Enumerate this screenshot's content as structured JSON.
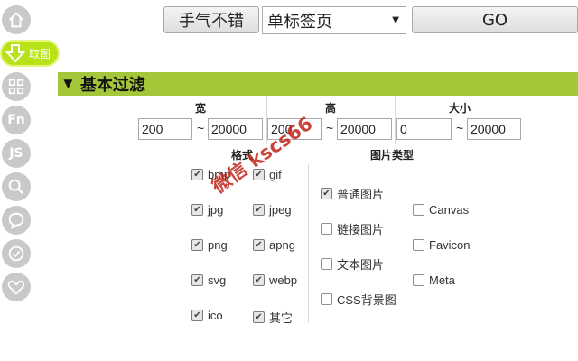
{
  "toolbar": {
    "lucky_button": "手气不错",
    "mode_select": "单标签页",
    "go_button": "GO"
  },
  "sidebar": {
    "active_label": "取图",
    "fn_label": "Fn",
    "js_label": "JS",
    "icons": [
      "home-icon",
      "download-icon",
      "grid-icon",
      "fn-icon",
      "js-icon",
      "search-icon",
      "chat-icon",
      "check-icon",
      "heart-icon"
    ]
  },
  "section": {
    "title": "基本过滤"
  },
  "size_filter": {
    "width_label": "宽",
    "height_label": "高",
    "size_label": "大小",
    "width_min": "200",
    "width_max": "20000",
    "height_min": "200",
    "height_max": "20000",
    "size_min": "0",
    "size_max": "20000",
    "tilde": "~"
  },
  "format_group": {
    "title": "格式",
    "items": [
      {
        "label": "bmp",
        "checked": true
      },
      {
        "label": "gif",
        "checked": true
      },
      {
        "label": "jpg",
        "checked": true
      },
      {
        "label": "jpeg",
        "checked": true
      },
      {
        "label": "png",
        "checked": true
      },
      {
        "label": "apng",
        "checked": true
      },
      {
        "label": "svg",
        "checked": true
      },
      {
        "label": "webp",
        "checked": true
      },
      {
        "label": "ico",
        "checked": true
      },
      {
        "label": "其它",
        "checked": true
      }
    ]
  },
  "type_group": {
    "title": "图片类型",
    "items": [
      {
        "label": "普通图片",
        "checked": true
      },
      {
        "label": "链接图片",
        "checked": false
      },
      {
        "label": "文本图片",
        "checked": false
      },
      {
        "label": "CSS背景图",
        "checked": false
      },
      {
        "label": "Canvas",
        "checked": false
      },
      {
        "label": "Favicon",
        "checked": false
      },
      {
        "label": "Meta",
        "checked": false
      }
    ]
  },
  "watermark": "微信 kscs66",
  "colors": {
    "accent": "#a4c639",
    "active": "#b7e21a",
    "sidebar_icon": "#c9c9c9",
    "watermark": "#c02418"
  }
}
